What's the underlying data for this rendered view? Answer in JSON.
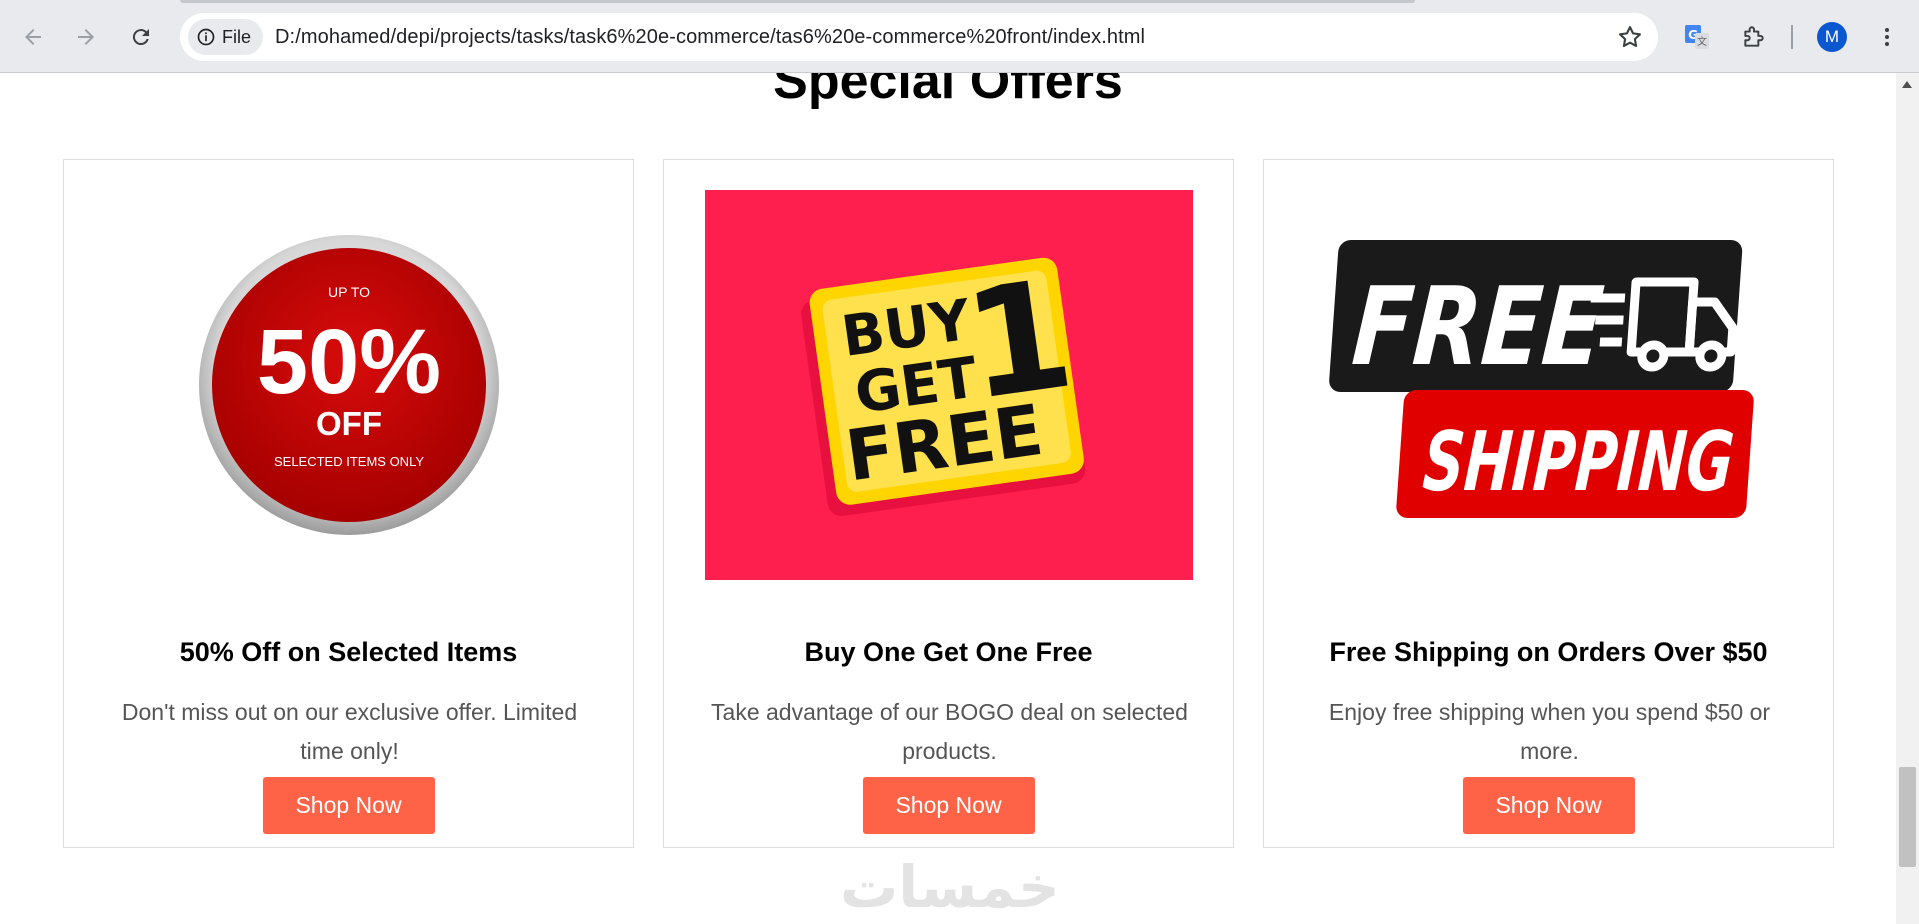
{
  "browser": {
    "site_chip_label": "File",
    "url": "D:/mohamed/depi/projects/tasks/task6%20e-commerce/tas6%20e-commerce%20front/index.html",
    "profile_initial": "M"
  },
  "page": {
    "section_title": "Special Offers",
    "watermark": "خمسات",
    "offers": [
      {
        "image": {
          "top_text": "UP TO",
          "big_text": "50%",
          "mid_text": "OFF",
          "bottom_text": "SELECTED ITEMS ONLY",
          "color": "#c50505"
        },
        "title": "50% Off on Selected Items",
        "description": "Don't miss out on our exclusive offer. Limited time only!",
        "button_label": "Shop Now"
      },
      {
        "image": {
          "line1": "BUY",
          "line2": "GET",
          "line3": "FREE",
          "number": "1",
          "background": "#ff1f4f",
          "badge_color": "#ffd500"
        },
        "title": "Buy One Get One Free",
        "description": "Take advantage of our BOGO deal on selected products.",
        "button_label": "Shop Now"
      },
      {
        "image": {
          "word1": "FREE",
          "word2": "SHIPPING",
          "dark": "#1a1a1a",
          "red": "#e00000"
        },
        "title": "Free Shipping on Orders Over $50",
        "description": "Enjoy free shipping when you spend $50 or more.",
        "button_label": "Shop Now"
      }
    ]
  },
  "colors": {
    "button": "#ff6347",
    "chrome_bg": "#e8eaed",
    "avatar": "#0b57d0"
  }
}
